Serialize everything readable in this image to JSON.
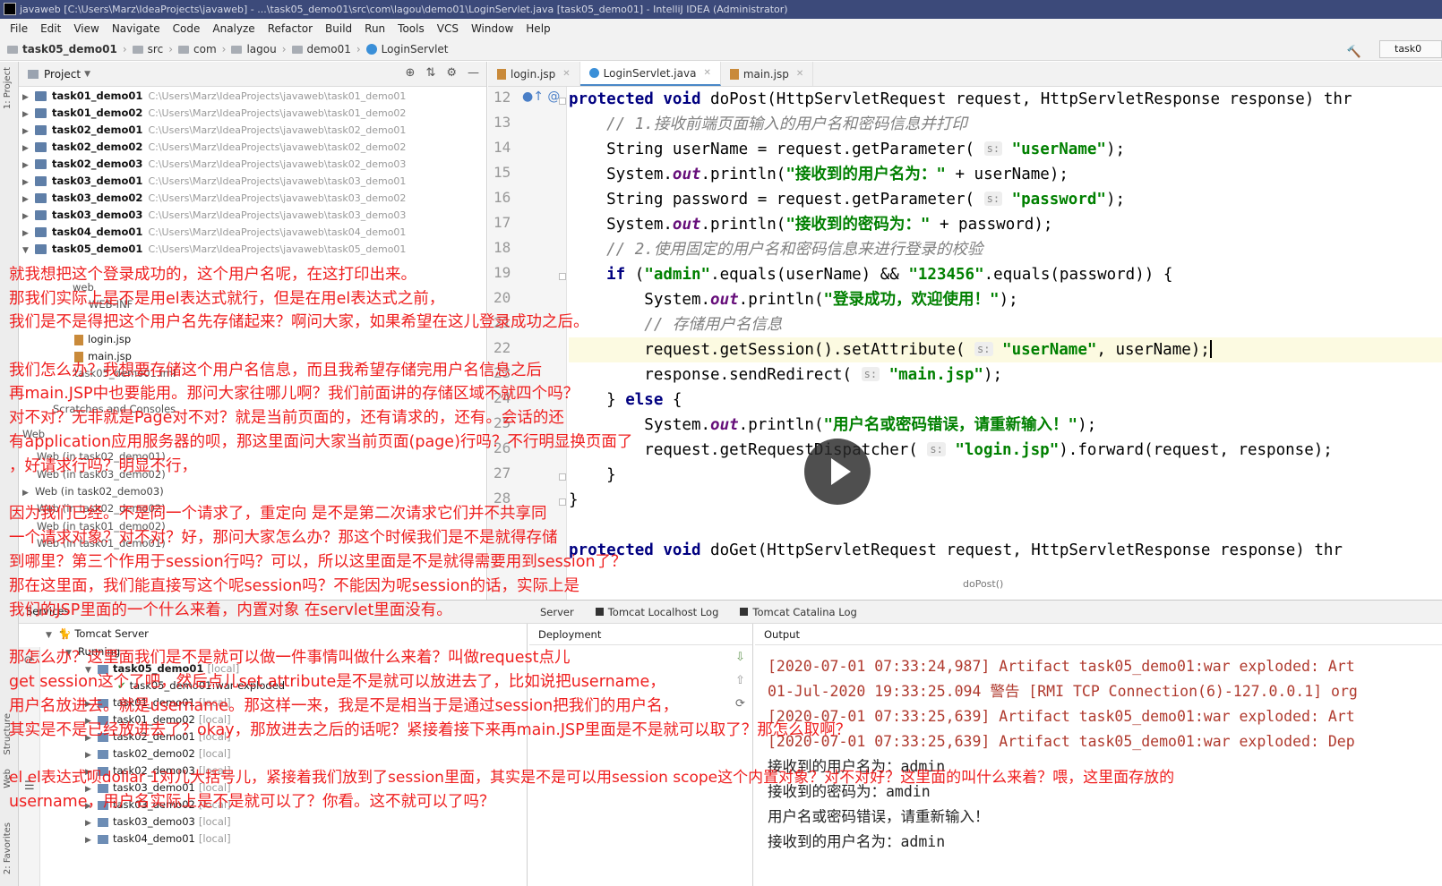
{
  "window": {
    "title": "javaweb [C:\\Users\\Marz\\IdeaProjects\\javaweb] - ...\\task05_demo01\\src\\com\\lagou\\demo01\\LoginServlet.java [task05_demo01] - IntelliJ IDEA (Administrator)"
  },
  "menu": [
    "File",
    "Edit",
    "View",
    "Navigate",
    "Code",
    "Analyze",
    "Refactor",
    "Build",
    "Run",
    "Tools",
    "VCS",
    "Window",
    "Help"
  ],
  "navbar": {
    "crumbs": [
      "task05_demo01",
      "src",
      "com",
      "lagou",
      "demo01",
      "LoginServlet"
    ],
    "run_config": "task0"
  },
  "left_stripe": {
    "project_tab": "1: Project",
    "structure_tab": "Structure",
    "web_tab": "Web",
    "favorites_tab": "2: Favorites"
  },
  "project": {
    "header": "Project",
    "modules": [
      {
        "name": "task01_demo01",
        "path": "C:\\Users\\Marz\\IdeaProjects\\javaweb\\task01_demo01"
      },
      {
        "name": "task01_demo02",
        "path": "C:\\Users\\Marz\\IdeaProjects\\javaweb\\task01_demo02"
      },
      {
        "name": "task02_demo01",
        "path": "C:\\Users\\Marz\\IdeaProjects\\javaweb\\task02_demo01"
      },
      {
        "name": "task02_demo02",
        "path": "C:\\Users\\Marz\\IdeaProjects\\javaweb\\task02_demo02"
      },
      {
        "name": "task02_demo03",
        "path": "C:\\Users\\Marz\\IdeaProjects\\javaweb\\task02_demo03"
      },
      {
        "name": "task03_demo01",
        "path": "C:\\Users\\Marz\\IdeaProjects\\javaweb\\task03_demo01"
      },
      {
        "name": "task03_demo02",
        "path": "C:\\Users\\Marz\\IdeaProjects\\javaweb\\task03_demo02"
      },
      {
        "name": "task03_demo03",
        "path": "C:\\Users\\Marz\\IdeaProjects\\javaweb\\task03_demo03"
      },
      {
        "name": "task04_demo01",
        "path": "C:\\Users\\Marz\\IdeaProjects\\javaweb\\task04_demo01"
      },
      {
        "name": "task05_demo01",
        "path": "C:\\Users\\Marz\\IdeaProjects\\javaweb\\task05_demo01"
      }
    ],
    "sub_items": {
      "web": "web",
      "web_inf": "WEB-INF",
      "login_jsp": "login.jsp",
      "main_jsp": "main.jsp",
      "task05_iml": "task05_demo01.iml",
      "scratches": "Scratches and Consoles",
      "web_group": "Web",
      "web_task02_demo01": "Web (in task02_demo01)",
      "web_task03_demo02": "Web (in task03_demo02)",
      "web_task02_demo03": "Web (in task02_demo03)",
      "web_task02_demo02": "Web (in task02_demo02)",
      "web_task01_demo02": "Web (in task01_demo02)",
      "web_task01_demo01": "Web (in task01_demo01)"
    }
  },
  "editor": {
    "tabs": [
      {
        "label": "login.jsp",
        "active": false
      },
      {
        "label": "LoginServlet.java",
        "active": true
      },
      {
        "label": "main.jsp",
        "active": false
      }
    ],
    "line_numbers": [
      "12",
      "13",
      "14",
      "15",
      "16",
      "17",
      "18",
      "19",
      "20",
      "21",
      "22",
      "23",
      "24",
      "25",
      "26",
      "27",
      "28"
    ],
    "code": {
      "l12_kw": "protected void ",
      "l12_rest": "doPost(HttpServletRequest request, HttpServletResponse response) thr",
      "l13": "    // 1.接收前端页面输入的用户名和密码信息并打印",
      "l14_a": "    String userName = request.getParameter( ",
      "l14_hint": "s:",
      "l14_str": " \"userName\"",
      "l14_end": ");",
      "l15_a": "    System.",
      "l15_fld": "out",
      "l15_b": ".println(",
      "l15_str": "\"接收到的用户名为：\"",
      "l15_end": " + userName);",
      "l16_a": "    String password = request.getParameter( ",
      "l16_hint": "s:",
      "l16_str": " \"password\"",
      "l16_end": ");",
      "l17_a": "    System.",
      "l17_fld": "out",
      "l17_b": ".println(",
      "l17_str": "\"接收到的密码为：\"",
      "l17_end": " + password);",
      "l18": "    // 2.使用固定的用户名和密码信息来进行登录的校验",
      "l19_kw": "    if ",
      "l19_a": "(",
      "l19_str1": "\"admin\"",
      "l19_b": ".equals(userName) && ",
      "l19_str2": "\"123456\"",
      "l19_c": ".equals(password)) {",
      "l20_a": "        System.",
      "l20_fld": "out",
      "l20_b": ".println(",
      "l20_str": "\"登录成功，欢迎使用！\"",
      "l20_end": ");",
      "l21": "        // 存储用户名信息",
      "l22_a": "        request.getSession().setAttribute( ",
      "l22_hint": "s:",
      "l22_str": " \"userName\"",
      "l22_end": ", userName);",
      "l23_a": "        response.sendRedirect( ",
      "l23_hint": "s:",
      "l23_str": " \"main.jsp\"",
      "l23_end": ");",
      "l24_a": "    } ",
      "l24_kw": "else",
      "l24_b": " {",
      "l25_a": "        System.",
      "l25_fld": "out",
      "l25_b": ".println(",
      "l25_str": "\"用户名或密码错误，请重新输入！\"",
      "l25_end": ");",
      "l26_a": "        request.getRequestDispatcher( ",
      "l26_hint": "s:",
      "l26_str": " \"login.jsp\"",
      "l26_end": ").forward(request, response);",
      "l27": "    }",
      "l28": "}",
      "l29_kw": "protected void ",
      "l29_rest": "doGet(HttpServletRequest request, HttpServletResponse response) thr"
    },
    "breadcrumb": "doPost()"
  },
  "services": {
    "title": "Services",
    "tree": {
      "tomcat_server": "Tomcat Server",
      "running": "Running",
      "task05": "task05_demo01",
      "task05_local": "[local]",
      "task05_war": "task05_demo01:war exploded",
      "task01_demo01": "task01_demo01",
      "task01_demo02": "task01_demo02",
      "task02_demo01": "task02_demo01",
      "task02_demo02": "task02_demo02",
      "task02_demo03": "task02_demo03",
      "task03_demo01": "task03_demo01",
      "task03_demo02": "task03_demo02",
      "task03_demo03": "task03_demo03",
      "task04_demo01": "task04_demo01",
      "local": "[local]"
    },
    "log_tabs": [
      "Server",
      "Tomcat Localhost Log",
      "Tomcat Catalina Log"
    ],
    "deployment_header": "Deployment",
    "output_header": "Output",
    "output_lines": [
      "[2020-07-01 07:33:24,987] Artifact task05_demo01:war exploded: Art",
      "01-Jul-2020 19:33:25.094 警告 [RMI TCP Connection(6)-127.0.0.1] org",
      "[2020-07-01 07:33:25,639] Artifact task05_demo01:war exploded: Art",
      "[2020-07-01 07:33:25,639] Artifact task05_demo01:war exploded: Dep",
      "接收到的用户名为：admin",
      "接收到的密码为：amdin",
      "用户名或密码错误，请重新输入！",
      "接收到的用户名为：admin"
    ]
  },
  "subtitles": [
    "就我想把这个登录成功的，这个用户名呢，在这打印出来。",
    "那我们实际上是不是用el表达式就行，但是在用el表达式之前，",
    "我们是不是得把这个用户名先存储起来？啊问大家，如果希望在这儿登录成功之后。",
    "我们怎么办？我想要存储这个用户名信息，而且我希望存储完用户名信息之后",
    "再main.JSP中也要能用。那问大家往哪儿啊？我们前面讲的存储区域不就四个吗？",
    "对不对？无非就是Page对不对？就是当前页面的，还有请求的，还有。会话的还",
    "有application应用服务器的呗，那这里面问大家当前页面(page)行吗？不行明显换页面了",
    "，好请求行吗？明显不行，",
    "因为我们已经。不是同一个请求了，重定向 是不是第二次请求它们并不共享同",
    "一个请求对象？对不对？好，那问大家怎么办？那这个时候我们是不是就得存储",
    "到哪里？第三个作用于session行吗？可以，所以这里面是不是就得需要用到session了？",
    "那在这里面，我们能直接写这个呢session吗？不能因为呢session的话，实际上是",
    "我们的JSP里面的一个什么来着，内置对象   在servlet里面没有。",
    "那怎么办？这里面我们是不是就可以做一件事情叫做什么来着？叫做request点儿",
    "get session这个了吧，然后点儿set attribute是不是就可以放进去了，比如说把username，",
    "用户名放进去。就是username。那这样一来，我是不是相当于是通过session把我们的用户名，",
    "其实是不是已经放进去了？okay，那放进去之后的话呢？紧接着接下来再main.JSP里面是不是就可以取了？那怎么取啊？",
    "el el表达式呗dollar 1对儿大括号儿，紧接着我们放到了session里面，其实是不是可以用session scope这个内置对象？对不对好？这里面的叫什么来着？喂，这里面存放的",
    "username，用户名实际上是不是就可以了？你看。这不就可以了吗？"
  ]
}
